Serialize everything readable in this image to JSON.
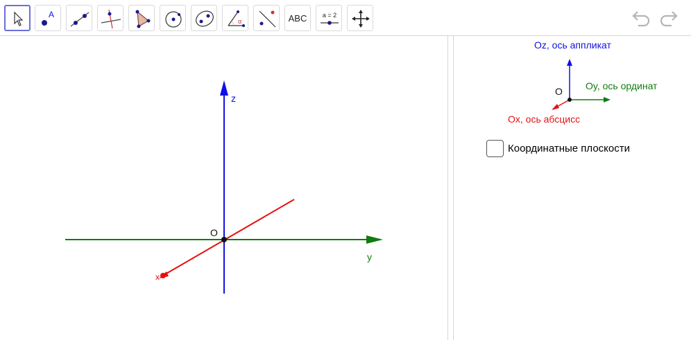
{
  "toolbar": {
    "tools": [
      {
        "id": "move",
        "icon": "cursor-arrow-icon"
      },
      {
        "id": "point",
        "icon": "point-icon",
        "letter": "A"
      },
      {
        "id": "line",
        "icon": "line-icon"
      },
      {
        "id": "perpendicular",
        "icon": "perpendicular-line-icon"
      },
      {
        "id": "polygon",
        "icon": "polygon-icon"
      },
      {
        "id": "circle",
        "icon": "circle-center-point-icon"
      },
      {
        "id": "ellipse",
        "icon": "ellipse-icon"
      },
      {
        "id": "angle",
        "icon": "angle-icon",
        "letter": "α"
      },
      {
        "id": "reflect",
        "icon": "reflect-about-line-icon"
      },
      {
        "id": "text",
        "icon": "text-icon",
        "label": "ABC"
      },
      {
        "id": "slider",
        "icon": "slider-icon",
        "label": "a = 2"
      },
      {
        "id": "move-view",
        "icon": "move-graphics-view-icon"
      }
    ],
    "undo_icon": "undo-icon",
    "redo_icon": "redo-icon"
  },
  "graphics": {
    "axis_z_label": "z",
    "axis_y_label": "y",
    "axis_x_label": "x",
    "origin_label": "O",
    "colors": {
      "z": "#1010e6",
      "y": "#107c10",
      "x": "#e61010"
    }
  },
  "legend": {
    "z_label": "Oz, ось аппликат",
    "y_label": "Oy, ось ординат",
    "x_label": "Ox, ось абсцисс",
    "origin_label": "O"
  },
  "checkbox": {
    "label": "Координатные плоскости",
    "checked": false
  }
}
